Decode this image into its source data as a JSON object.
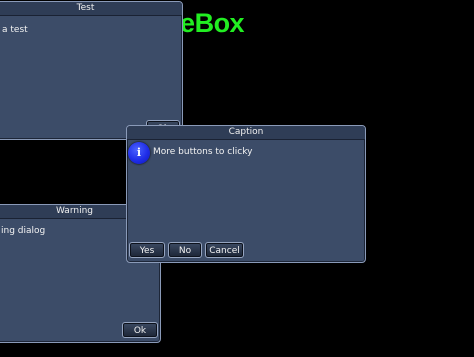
{
  "app": {
    "title": "MessageBox"
  },
  "dialogs": {
    "test": {
      "title": "Test",
      "message": "a test",
      "ok_label": "Ok"
    },
    "warning": {
      "title": "Warning",
      "message": "ing dialog",
      "ok_label": "Ok"
    },
    "caption": {
      "title": "Caption",
      "message": "More buttons to clicky",
      "icon": "info-icon",
      "icon_glyph": "i",
      "buttons": {
        "yes": "Yes",
        "no": "No",
        "cancel": "Cancel"
      }
    }
  },
  "colors": {
    "background": "#000000",
    "app_title": "#22ee22",
    "dialog_body": "#3c4c68",
    "dialog_border": "#8a9ab8",
    "info_icon": "#1f2de8"
  }
}
